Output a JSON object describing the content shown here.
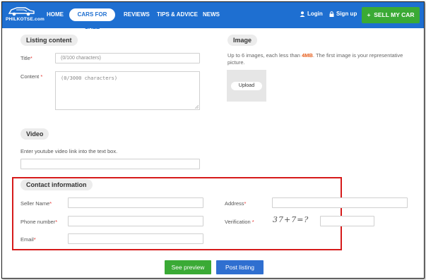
{
  "nav": {
    "logo_text": "PHILKOTSE.com",
    "items": [
      {
        "label": "HOME"
      },
      {
        "label": "CARS FOR SALE"
      },
      {
        "label": "REVIEWS"
      },
      {
        "label": "TIPS & ADVICE"
      },
      {
        "label": "NEWS"
      }
    ],
    "login_label": "Login",
    "signup_label": "Sign up",
    "sell_label": "SELL MY CAR",
    "sell_icon": "+"
  },
  "listing": {
    "section_title": "Listing content",
    "title_label": "Title",
    "title_placeholder": "(0/100 characters)",
    "content_label": "Content",
    "content_placeholder": "(0/3000 characters)"
  },
  "image": {
    "section_title": "Image",
    "desc_prefix": "Up to 6 images, each less than ",
    "desc_size": "4MB",
    "desc_suffix": ". The first image is your representative picture.",
    "upload_label": "Upload"
  },
  "video": {
    "section_title": "Video",
    "desc": "Enter youtube video link into the text box."
  },
  "contact": {
    "section_title": "Contact information",
    "seller_name_label": "Seller Name",
    "phone_label": "Phone number",
    "email_label": "Email",
    "address_label": "Address",
    "verification_label": "Verification",
    "captcha_text": "37+7=?"
  },
  "required_mark": "*",
  "actions": {
    "preview_label": "See preview",
    "post_label": "Post listing"
  },
  "colors": {
    "nav_bg": "#1e6fd1",
    "sell_green": "#3aaa35",
    "post_blue": "#2f6fd0",
    "highlight_red": "#d61a1a",
    "accent_orange": "#e65c1a"
  }
}
